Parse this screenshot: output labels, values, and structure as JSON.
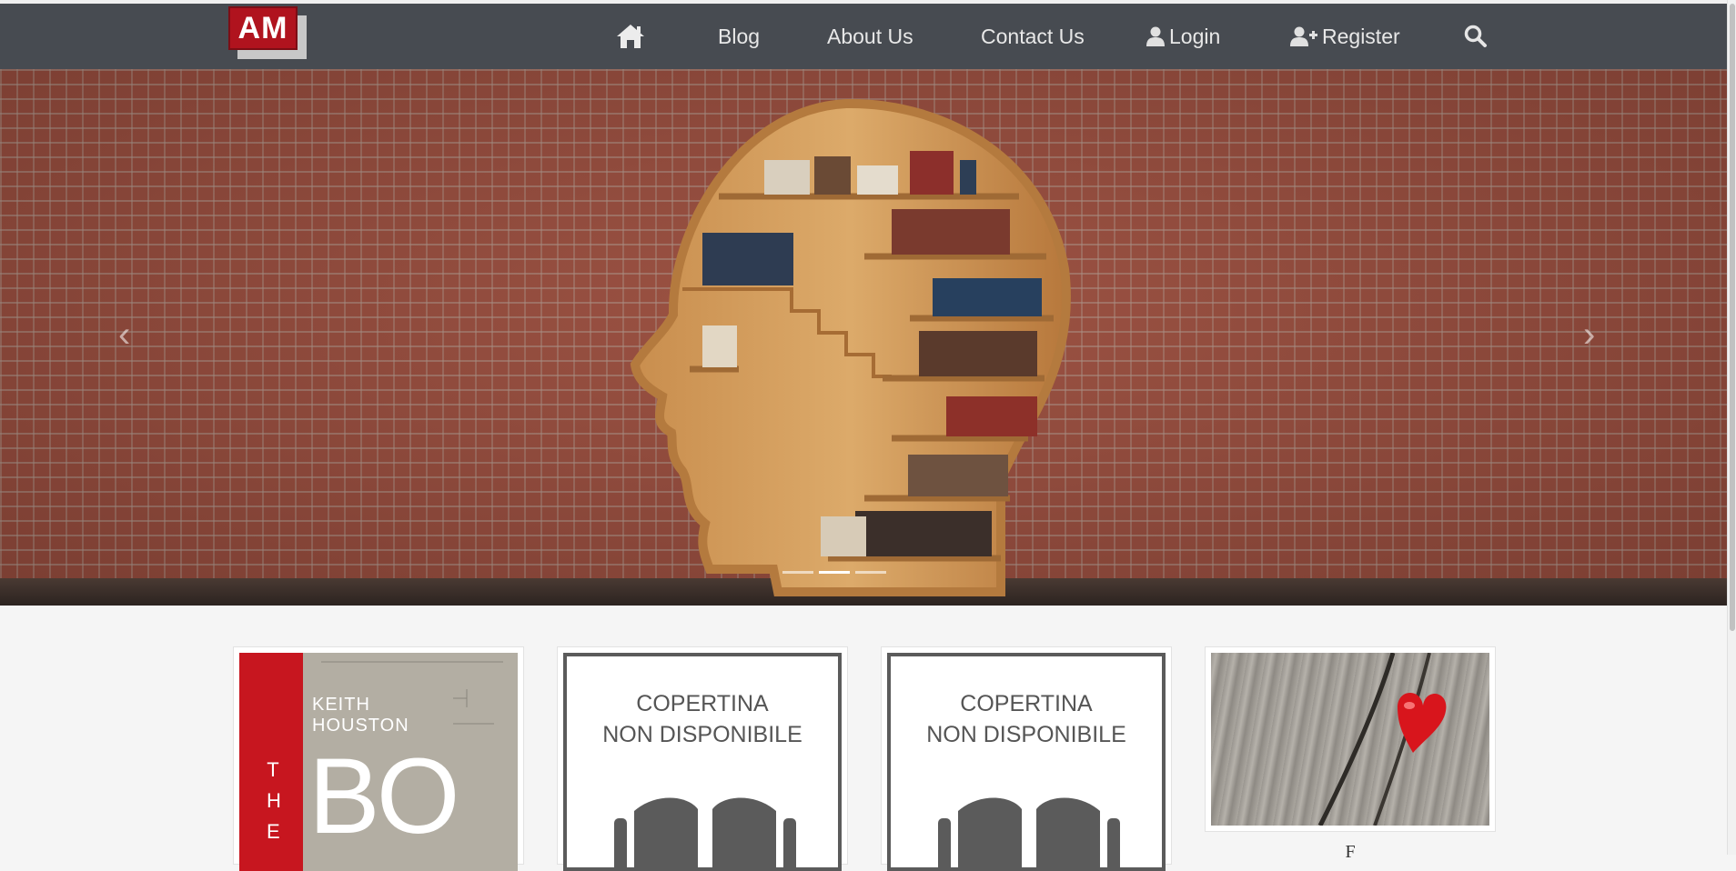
{
  "logo": {
    "text": "AM"
  },
  "nav": {
    "home_icon": "home-icon",
    "blog": "Blog",
    "about": "About Us",
    "contact": "Contact Us",
    "login": "Login",
    "register": "Register",
    "search_icon": "search-icon"
  },
  "hero": {
    "image": "head-shaped-bookshelf-on-brick-wall",
    "slide_count": 3,
    "active_slide": 1
  },
  "cards": [
    {
      "type": "book-cover",
      "author": "KEITH\nHOUSTON",
      "spine": "THE",
      "title_fragment": "BO"
    },
    {
      "type": "placeholder",
      "line1": "COPERTINA",
      "line2": "NON DISPONIBILE"
    },
    {
      "type": "placeholder",
      "line1": "COPERTINA",
      "line2": "NON DISPONIBILE"
    },
    {
      "type": "image",
      "image": "red-heart-in-wood-crack"
    }
  ],
  "caption4": "F",
  "colors": {
    "navbar": "#474b51",
    "logo_red": "#b0131e",
    "spine_red": "#c7161f"
  }
}
